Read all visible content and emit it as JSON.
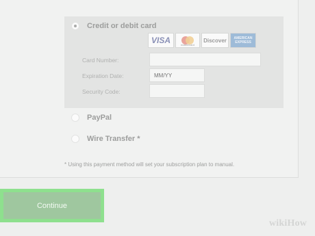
{
  "payment": {
    "card_option": {
      "label": "Credit or debit card",
      "selected": true
    },
    "card_logos": [
      {
        "name": "visa-logo",
        "text": "VISA"
      },
      {
        "name": "mastercard-logo",
        "text": "mastercard"
      },
      {
        "name": "discover-logo",
        "text": "Discover"
      },
      {
        "name": "amex-logo",
        "text": "AMERICAN EXPRESS"
      }
    ],
    "fields": {
      "card_number": {
        "label": "Card Number:",
        "value": "",
        "placeholder": ""
      },
      "expiration_date": {
        "label": "Expiration Date:",
        "value": "",
        "placeholder": "MM/YY"
      },
      "security_code": {
        "label": "Security Code:",
        "value": "",
        "placeholder": ""
      }
    },
    "paypal_option": {
      "label": "PayPal",
      "selected": false
    },
    "wire_option": {
      "label": "Wire Transfer *",
      "selected": false
    },
    "note": "* Using this payment method will set your subscription plan to manual."
  },
  "continue_label": "Continue",
  "watermark": "wikiHow",
  "colors": {
    "button_highlight": "#8ee08e",
    "button": "#9fc79f",
    "card_block": "#e3e4e3"
  }
}
